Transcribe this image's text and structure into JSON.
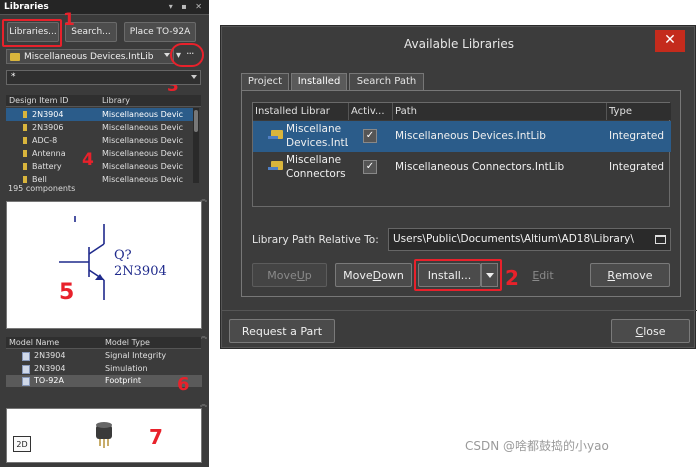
{
  "panel": {
    "title": "Libraries",
    "buttons": {
      "libraries": "Libraries...",
      "search": "Search...",
      "place": "Place TO-92A"
    },
    "current_library": "Miscellaneous Devices.IntLib",
    "filter_value": "*",
    "columns": {
      "design_item_id": "Design Item ID",
      "library": "Library"
    },
    "components": [
      {
        "id": "2N3904",
        "library": "Miscellaneous Devic",
        "selected": true
      },
      {
        "id": "2N3906",
        "library": "Miscellaneous Devic",
        "selected": false
      },
      {
        "id": "ADC-8",
        "library": "Miscellaneous Devic",
        "selected": false
      },
      {
        "id": "Antenna",
        "library": "Miscellaneous Devic",
        "selected": false
      },
      {
        "id": "Battery",
        "library": "Miscellaneous Devic",
        "selected": false
      },
      {
        "id": "Bell",
        "library": "Miscellaneous Devic",
        "selected": false
      }
    ],
    "component_count": "195 components",
    "schematic": {
      "designator": "Q?",
      "part": "2N3904"
    },
    "model_columns": {
      "name": "Model Name",
      "type": "Model Type"
    },
    "models": [
      {
        "name": "2N3904",
        "type": "Signal Integrity",
        "selected": false
      },
      {
        "name": "2N3904",
        "type": "Simulation",
        "selected": false
      },
      {
        "name": "TO-92A",
        "type": "Footprint",
        "selected": true
      }
    ],
    "view_2d_button": "2D"
  },
  "dialog": {
    "title": "Available Libraries",
    "close_glyph": "✕",
    "tabs": [
      "Project",
      "Installed",
      "Search Path"
    ],
    "active_tab": "Installed",
    "columns": {
      "installed_library": "Installed Librar",
      "active": "Activ...",
      "path": "Path",
      "type": "Type"
    },
    "libraries": [
      {
        "name_line1": "Miscellane",
        "name_line2": "Devices.IntLi",
        "active_check": "✓",
        "path": "Miscellaneous Devices.IntLib",
        "type": "Integrated",
        "selected": true
      },
      {
        "name_line1": "Miscellane",
        "name_line2": "Connectors",
        "active_check": "✓",
        "path": "Miscellaneous Connectors.IntLib",
        "type": "Integrated",
        "selected": false
      }
    ],
    "relative_path_label": "Library Path Relative To:",
    "relative_path_value": "Users\\Public\\Documents\\Altium\\AD18\\Library\\",
    "buttons": {
      "move_up_pre": "Move ",
      "move_up_key": "U",
      "move_up_post": "p",
      "move_down_pre": "Move ",
      "move_down_key": "D",
      "move_down_post": "own",
      "install": "Install...",
      "edit_key": "E",
      "edit_post": "dit",
      "remove_key": "R",
      "remove_post": "emove",
      "request_part": "Request a Part",
      "close_key": "C",
      "close_post": "lose"
    }
  },
  "annotations": [
    "1",
    "2",
    "3",
    "4",
    "5",
    "6",
    "7"
  ],
  "watermark": "CSDN @啥都鼓捣的小yao",
  "colors": {
    "annotation_red": "#e8212b",
    "selection_blue": "#2b5c8a",
    "panel_bg": "#3b3b3b",
    "close_red": "#c42b1c"
  }
}
